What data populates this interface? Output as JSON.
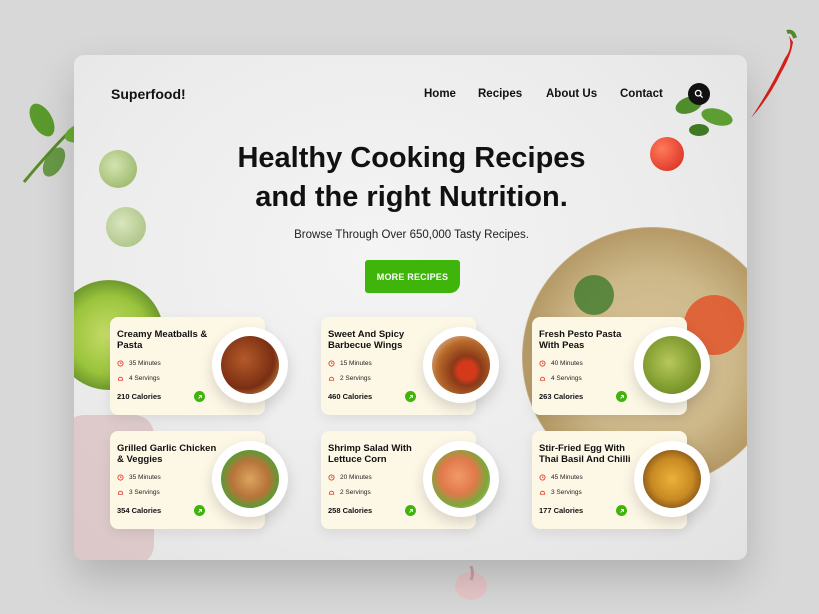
{
  "brand": "Superfood!",
  "nav": {
    "items": [
      {
        "label": "Home"
      },
      {
        "label": "Recipes"
      },
      {
        "label": "About Us"
      },
      {
        "label": "Contact"
      }
    ],
    "search_icon": "search-icon"
  },
  "hero": {
    "title_line1": "Healthy Cooking Recipes",
    "title_line2": "and the right Nutrition.",
    "subtitle": "Browse Through Over 650,000 Tasty Recipes.",
    "cta_label": "MORE RECIPES"
  },
  "colors": {
    "accent": "#3fb40b",
    "card_bg": "#fdf7e6",
    "text": "#111111"
  },
  "recipes": [
    {
      "title": "Creamy Meatballs & Pasta",
      "time": "35 Minutes",
      "servings": "4 Servings",
      "calories": "210 Calories",
      "food_color": "#8a3a1f"
    },
    {
      "title": "Sweet And Spicy Barbecue Wings",
      "time": "15 Minutes",
      "servings": "2 Servings",
      "calories": "460 Calories",
      "food_color": "#a84a22"
    },
    {
      "title": "Fresh Pesto Pasta With Peas",
      "time": "40 Minutes",
      "servings": "4 Servings",
      "calories": "263 Calories",
      "food_color": "#8aa83a"
    },
    {
      "title": "Grilled Garlic Chicken & Veggies",
      "time": "35 Minutes",
      "servings": "3 Servings",
      "calories": "354 Calories",
      "food_color": "#c98a4a"
    },
    {
      "title": "Shrimp Salad  With Lettuce Corn",
      "time": "20 Minutes",
      "servings": "2 Servings",
      "calories": "258 Calories",
      "food_color": "#e0794a"
    },
    {
      "title": "Stir-Fried Egg With Thai Basil And Chilli",
      "time": "45 Minutes",
      "servings": "3 Servings",
      "calories": "177 Calories",
      "food_color": "#d39a2a"
    }
  ]
}
